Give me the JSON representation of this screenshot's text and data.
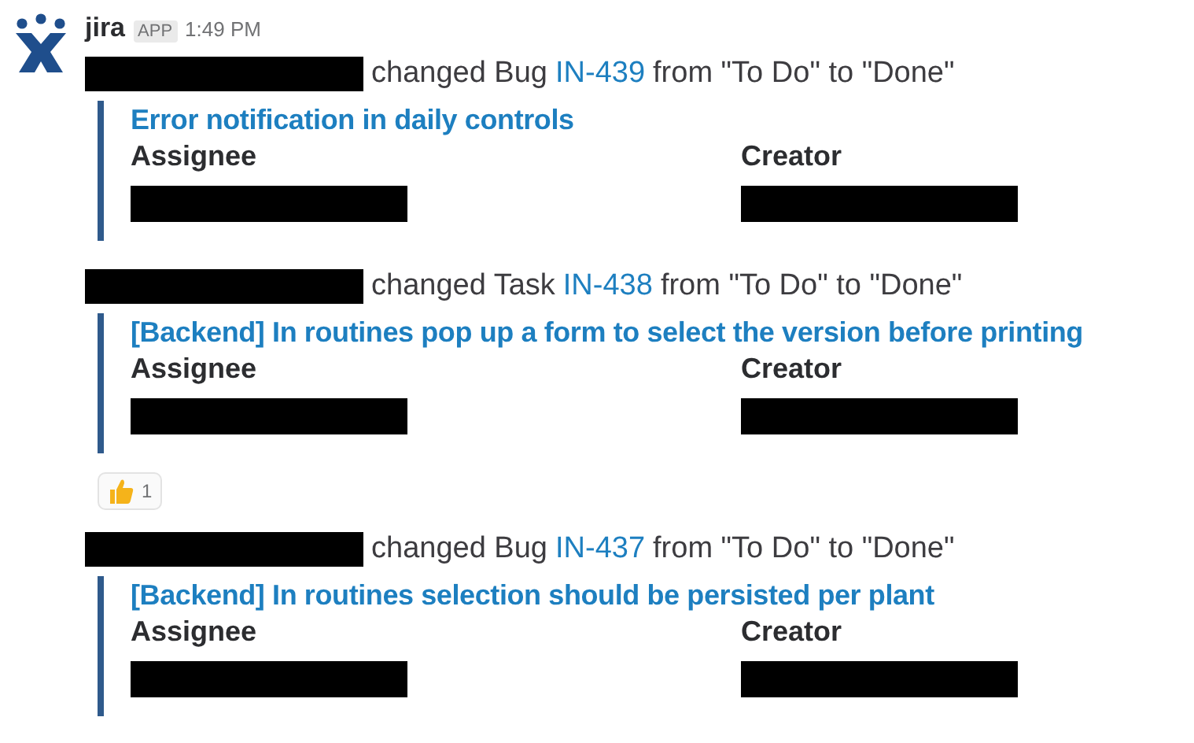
{
  "message": {
    "sender": "jira",
    "badge": "APP",
    "time": "1:49 PM"
  },
  "events": [
    {
      "verb": "changed Bug",
      "issue": "IN-439",
      "change": "from \"To Do\" to \"Done\"",
      "title": "Error notification in daily controls",
      "fields": [
        "Assignee",
        "Creator"
      ]
    },
    {
      "verb": "changed Task",
      "issue": "IN-438",
      "change": "from \"To Do\" to \"Done\"",
      "title": "[Backend] In routines pop up a form to select the version before printing",
      "fields": [
        "Assignee",
        "Creator"
      ],
      "reactions": [
        {
          "count": "1"
        }
      ]
    },
    {
      "verb": "changed Bug",
      "issue": "IN-437",
      "change": "from \"To Do\" to \"Done\"",
      "title": "[Backend] In routines selection should be persisted per plant",
      "fields": [
        "Assignee",
        "Creator"
      ]
    }
  ]
}
